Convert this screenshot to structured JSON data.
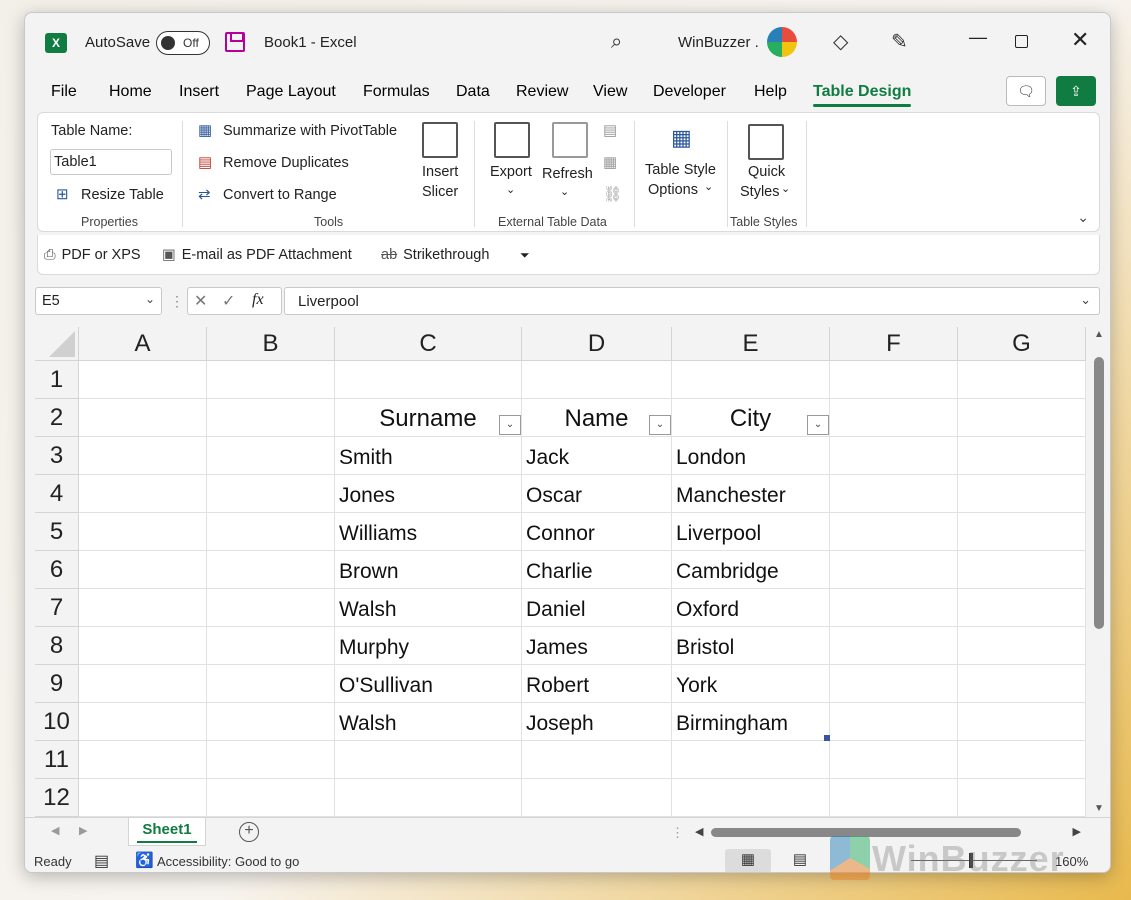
{
  "titlebar": {
    "autosave_label": "AutoSave",
    "autosave_state": "Off",
    "doc_title": "Book1  -  Excel",
    "user": "WinBuzzer .",
    "icons": [
      "excel-logo-icon",
      "save-icon",
      "search-icon",
      "diamond-icon",
      "pen-icon",
      "minimize-icon",
      "maximize-icon",
      "close-icon"
    ]
  },
  "tabs": [
    "File",
    "Home",
    "Insert",
    "Page Layout",
    "Formulas",
    "Data",
    "Review",
    "View",
    "Developer",
    "Help",
    "Table Design"
  ],
  "active_tab": "Table Design",
  "ribbon": {
    "properties": {
      "table_name_label": "Table Name:",
      "table_name_value": "Table1",
      "resize": "Resize Table",
      "group": "Properties"
    },
    "tools": {
      "summarize": "Summarize with PivotTable",
      "remove_dup": "Remove Duplicates",
      "convert": "Convert to Range",
      "insert_slicer_1": "Insert",
      "insert_slicer_2": "Slicer",
      "group": "Tools"
    },
    "external": {
      "export": "Export",
      "refresh": "Refresh",
      "group": "External Table Data"
    },
    "styles": {
      "style_options_1": "Table Style",
      "style_options_2": "Options",
      "quick_1": "Quick",
      "quick_2": "Styles",
      "group": "Table Styles"
    }
  },
  "qat": {
    "pdf": "PDF or XPS",
    "email": "E-mail as PDF Attachment",
    "strike": "Strikethrough"
  },
  "formula_bar": {
    "name_box": "E5",
    "fx": "fx",
    "value": "Liverpool"
  },
  "columns": [
    "A",
    "B",
    "C",
    "D",
    "E",
    "F",
    "G"
  ],
  "rows": [
    "1",
    "2",
    "3",
    "4",
    "5",
    "6",
    "7",
    "8",
    "9",
    "10",
    "11",
    "12"
  ],
  "table": {
    "headers": [
      "Surname",
      "Name",
      "City"
    ],
    "rows": [
      [
        "Smith",
        "Jack",
        "London"
      ],
      [
        "Jones",
        "Oscar",
        "Manchester"
      ],
      [
        "Williams",
        "Connor",
        "Liverpool"
      ],
      [
        "Brown",
        "Charlie",
        "Cambridge"
      ],
      [
        "Walsh",
        "Daniel",
        "Oxford"
      ],
      [
        "Murphy",
        "James",
        "Bristol"
      ],
      [
        "O'Sullivan",
        "Robert",
        "York"
      ],
      [
        "Walsh",
        "Joseph",
        "Birmingham"
      ]
    ]
  },
  "sheet_tab": "Sheet1",
  "status": {
    "ready": "Ready",
    "accessibility": "Accessibility: Good to go",
    "zoom": "160%"
  },
  "watermark": "WinBuzzer",
  "colors": {
    "accent": "#107c41",
    "handle": "#3a54a4"
  }
}
